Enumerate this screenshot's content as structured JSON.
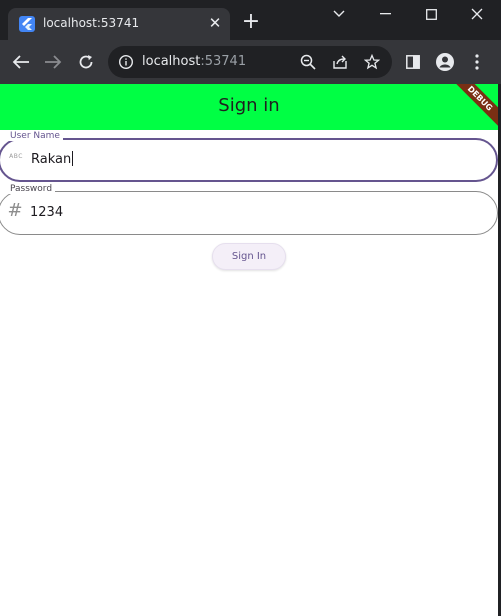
{
  "browser": {
    "tab": {
      "title": "localhost:53741",
      "favicon": "flutter-icon",
      "close_glyph": "✕"
    },
    "new_tab_glyph": "+",
    "url": {
      "host": "localhost",
      "port": ":53741"
    },
    "icons": [
      "back-icon",
      "forward-icon",
      "reload-icon",
      "info-icon",
      "zoom-out-icon",
      "share-icon",
      "star-icon",
      "side-panel-icon",
      "profile-icon",
      "menu-icon",
      "minimize-icon",
      "maximize-icon",
      "close-icon",
      "tab-search-icon"
    ]
  },
  "app": {
    "title": "Sign in",
    "debug_banner": "DEBUG",
    "colors": {
      "appbar": "#00ff44",
      "accent": "#65558f"
    }
  },
  "form": {
    "username": {
      "label": "User Name",
      "prefix": "ABC",
      "value": "Rakan"
    },
    "password": {
      "label": "Password",
      "prefix": "#",
      "value": "1234"
    },
    "submit_label": "Sign In"
  }
}
